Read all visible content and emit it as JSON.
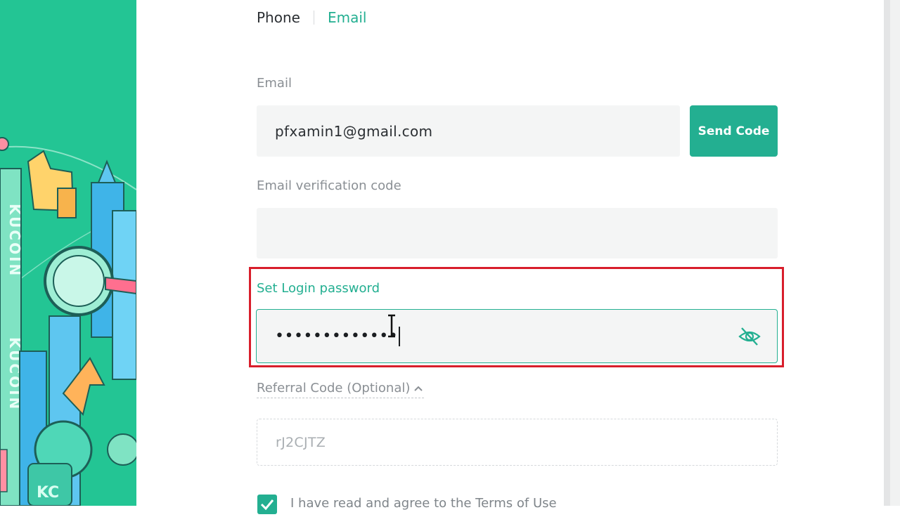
{
  "tabs": [
    {
      "label": "Phone",
      "active": false
    },
    {
      "label": "Email",
      "active": true
    }
  ],
  "email": {
    "label": "Email",
    "value": "pfxamin1@gmail.com",
    "send_code_label": "Send Code"
  },
  "verification": {
    "label": "Email verification code",
    "value": ""
  },
  "password": {
    "label": "Set Login password",
    "masked_value": "•••••••••••••"
  },
  "referral": {
    "label": "Referral Code (Optional)",
    "value": "rJ2CJTZ"
  },
  "terms": {
    "text": "I have read and agree to the Terms of Use",
    "checked": true
  },
  "illustration": {
    "text_1": "KUCOIN",
    "text_2": "KUCOIN",
    "badge": "KC"
  },
  "colors": {
    "accent": "#23af91",
    "panel": "#23c594",
    "highlight": "#d81e2b"
  }
}
